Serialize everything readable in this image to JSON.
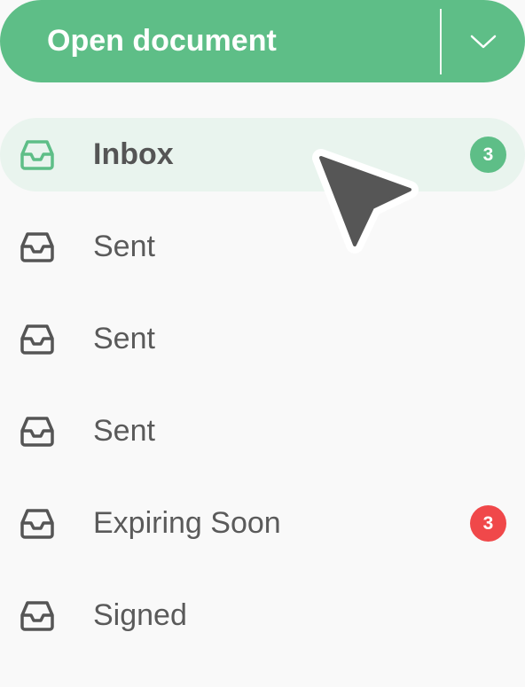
{
  "primary_action": {
    "label": "Open document",
    "dropdown_icon": "chevron-down-icon",
    "color": "#5ebe87"
  },
  "nav": {
    "items": [
      {
        "label": "Inbox",
        "icon": "inbox-icon",
        "active": true,
        "badge": "3",
        "badge_color": "#5ebe87"
      },
      {
        "label": "Sent",
        "icon": "inbox-icon",
        "active": false
      },
      {
        "label": "Sent",
        "icon": "inbox-icon",
        "active": false
      },
      {
        "label": "Sent",
        "icon": "inbox-icon",
        "active": false
      },
      {
        "label": "Expiring Soon",
        "icon": "inbox-icon",
        "active": false,
        "badge": "3",
        "badge_color": "#f0484a"
      },
      {
        "label": "Signed",
        "icon": "inbox-icon",
        "active": false
      }
    ]
  },
  "colors": {
    "active_background": "#e9f4ee",
    "active_icon": "#5ebe87",
    "default_icon": "#555555",
    "text": "#5a5a5a"
  },
  "cursor": {
    "icon": "mouse-pointer-icon"
  }
}
